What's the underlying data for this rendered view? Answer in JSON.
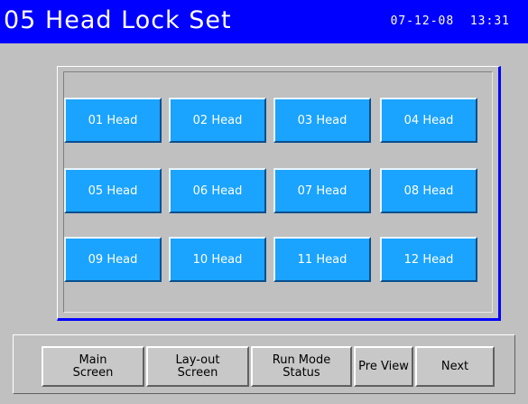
{
  "header": {
    "title": "05 Head Lock Set",
    "date": "07-12-08",
    "time": "13:31",
    "background_color": "#0000ff"
  },
  "heads": [
    {
      "label": "01 Head"
    },
    {
      "label": "02 Head"
    },
    {
      "label": "03 Head"
    },
    {
      "label": "04 Head"
    },
    {
      "label": "05 Head"
    },
    {
      "label": "06 Head"
    },
    {
      "label": "07 Head"
    },
    {
      "label": "08 Head"
    },
    {
      "label": "09 Head"
    },
    {
      "label": "10 Head"
    },
    {
      "label": "11 Head"
    },
    {
      "label": "12 Head"
    }
  ],
  "head_button_color": "#1aa3ff",
  "nav": {
    "main_screen": {
      "line1": "Main",
      "line2": "Screen"
    },
    "layout_screen": {
      "line1": "Lay-out",
      "line2": "Screen"
    },
    "run_mode_status": {
      "line1": "Run Mode",
      "line2": "Status"
    },
    "pre_view": {
      "label": "Pre View"
    },
    "next": {
      "label": "Next"
    }
  }
}
